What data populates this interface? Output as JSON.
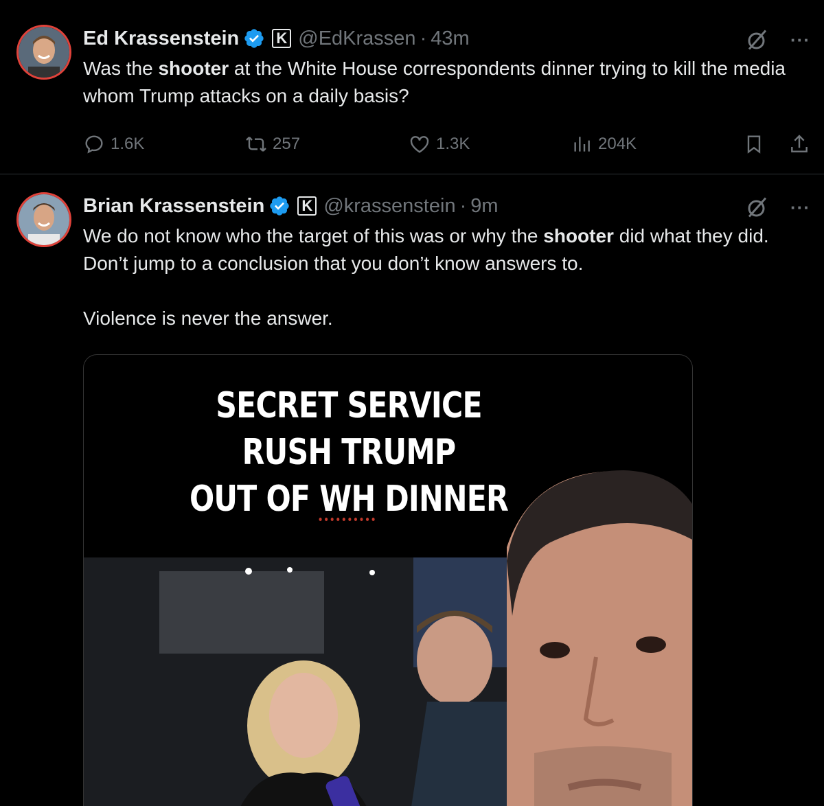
{
  "posts": [
    {
      "author_name": "Ed Krassenstein",
      "handle": "@EdKrassen",
      "separator": "·",
      "time": "43m",
      "badge_letter": "K",
      "text_before": "Was the ",
      "text_bold": "shooter",
      "text_after": " at the White House correspondents dinner trying to kill the media whom Trump attacks on a daily basis?",
      "replies": "1.6K",
      "reposts": "257",
      "likes": "1.3K",
      "views": "204K",
      "more": "···"
    },
    {
      "author_name": "Brian Krassenstein",
      "handle": "@krassenstein",
      "separator": "·",
      "time": "9m",
      "badge_letter": "K",
      "text_before": "We do not know who the target of this was or why the ",
      "text_bold": "shooter",
      "text_after": " did what they did. Don’t jump to a conclusion that you don’t know answers to.",
      "text_para2": "Violence is never the answer.",
      "more": "···",
      "media": {
        "headline_line1": "SECRET SERVICE RUSH TRUMP",
        "headline_line2_pre": "OUT OF ",
        "headline_line2_underlined": "WH",
        "headline_line2_post": " DINNER"
      }
    }
  ],
  "colors": {
    "background": "#000000",
    "text": "#e7e9ea",
    "muted": "#71767b",
    "verified": "#1d9bf0",
    "avatar_ring": "#e0423a",
    "divider": "#2f3336"
  },
  "icons": [
    "reply-icon",
    "repost-icon",
    "like-icon",
    "views-icon",
    "bookmark-icon",
    "share-icon",
    "grok-icon",
    "verified-badge-icon",
    "more-icon"
  ]
}
